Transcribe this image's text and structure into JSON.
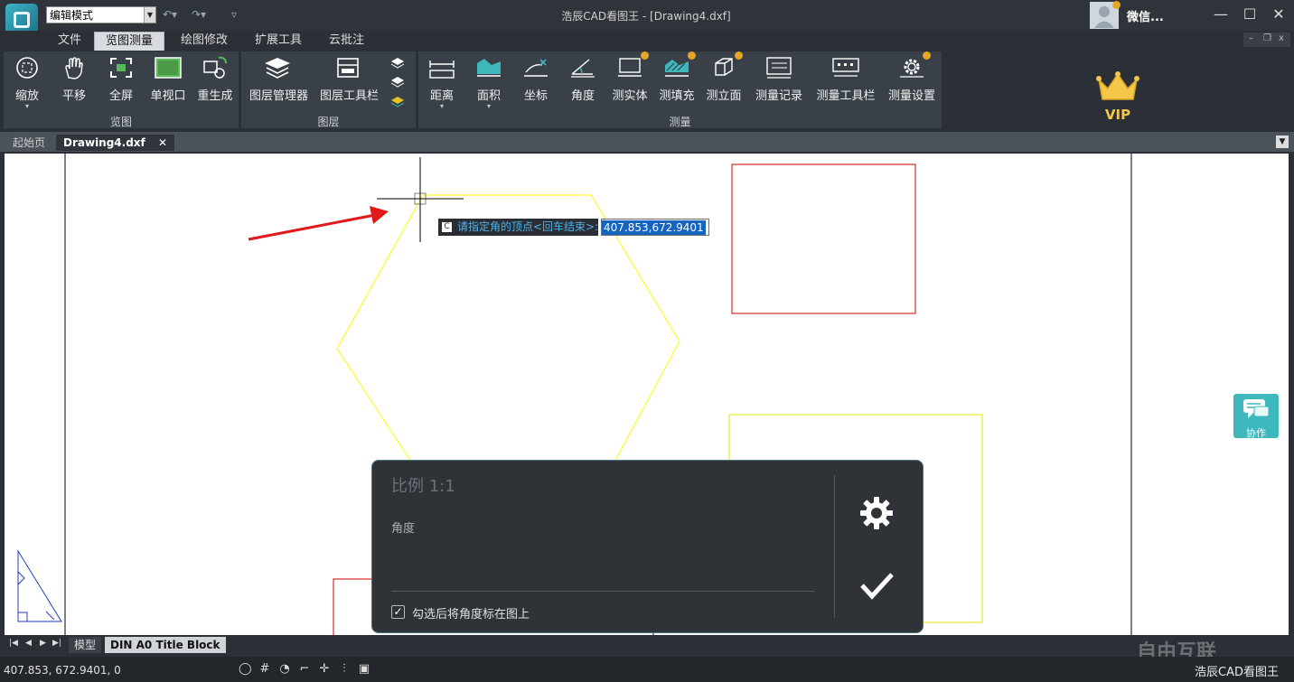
{
  "titlebar": {
    "mode_value": "编辑模式",
    "title": "浩辰CAD看图王 - [Drawing4.dxf]",
    "user_name": "微信...",
    "minimize": "—",
    "maximize": "☐",
    "close": "✕"
  },
  "menu": {
    "tabs": [
      "文件",
      "览图测量",
      "绘图修改",
      "扩展工具",
      "云批注"
    ],
    "active": "览图测量"
  },
  "ribbon": {
    "groups": [
      "览图",
      "图层",
      "测量"
    ],
    "view_tools": [
      "缩放",
      "平移",
      "全屏",
      "单视口",
      "重生成"
    ],
    "layer_tools": [
      "图层管理器",
      "图层工具栏"
    ],
    "measure_tools": [
      "距离",
      "面积",
      "坐标",
      "角度",
      "测实体",
      "测填充",
      "测立面",
      "测量记录",
      "测量工具栏",
      "测量设置"
    ],
    "vip_label": "VIP"
  },
  "doc_tabs": [
    "起始页",
    "Drawing4.dxf"
  ],
  "command": {
    "prompt": "请指定角的顶点<回车结束>:",
    "value": "407.853,672.9401"
  },
  "collab": {
    "label": "协作"
  },
  "angle_panel": {
    "scale": "比例 1:1",
    "angle_label": "角度",
    "checkbox_label": "勾选后将角度标在图上",
    "checked": true
  },
  "layout_tabs": [
    "模型",
    "DIN A0 Title Block"
  ],
  "status": {
    "coords": "407.853, 672.9401, 0",
    "brand": "浩辰CAD看图王",
    "watermark": "自由互联"
  },
  "colors": {
    "accent": "#3fb8bd",
    "hexagon": "#ffff00",
    "red_rect": "#cc0000",
    "arrow": "#e0191b"
  }
}
